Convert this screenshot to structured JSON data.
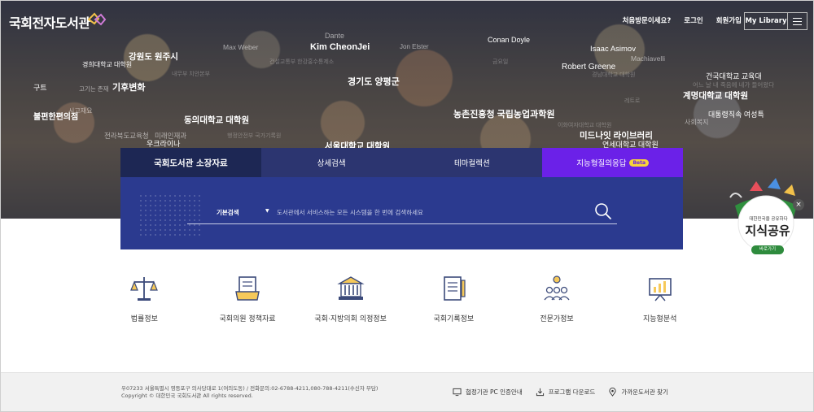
{
  "header": {
    "logo": "국회전자도서관",
    "links": [
      "처음방문이세요?",
      "로그인",
      "회원가입"
    ],
    "my_library": "My Library"
  },
  "keywords": [
    {
      "text": "Dante"
    },
    {
      "text": "Kim CheonJei"
    },
    {
      "text": "Max Weber"
    },
    {
      "text": "Jon Elster"
    },
    {
      "text": "Conan Doyle"
    },
    {
      "text": "Isaac Asimov"
    },
    {
      "text": "Machiavelli"
    },
    {
      "text": "Robert Greene"
    },
    {
      "text": "강원도 원주시"
    },
    {
      "text": "경희대학교 대학원"
    },
    {
      "text": "기후변화"
    },
    {
      "text": "경기도 양평군"
    },
    {
      "text": "건국대학교 교육대"
    },
    {
      "text": "계명대학교 대학원"
    },
    {
      "text": "대통령직속 여성특"
    },
    {
      "text": "사회복지"
    },
    {
      "text": "농촌진흥청 국립농업과학원"
    },
    {
      "text": "동의대학교 대학원"
    },
    {
      "text": "불편한편의점"
    },
    {
      "text": "전라북도교육청"
    },
    {
      "text": "미래인재과"
    },
    {
      "text": "우크라이나"
    },
    {
      "text": "미드나잇 라이브러리"
    },
    {
      "text": "연세대학교 대학원"
    },
    {
      "text": "서울대학교 대학원"
    },
    {
      "text": "구트"
    },
    {
      "text": "고기는 존재"
    },
    {
      "text": "행정안전부 국가기록원"
    },
    {
      "text": "내무부 치안본부"
    },
    {
      "text": "건설교통부 한강홍수통제소"
    },
    {
      "text": "금요일"
    },
    {
      "text": "시고재요"
    },
    {
      "text": "레트로"
    },
    {
      "text": "경남대학교 대학원"
    },
    {
      "text": "이화여자대학교 대학원"
    },
    {
      "text": "어느 날 내 죽음에 네가 들어왔다"
    }
  ],
  "tabs": [
    {
      "label": "국회도서관 소장자료"
    },
    {
      "label": "상세검색"
    },
    {
      "label": "테마컬렉션"
    },
    {
      "label": "지능형질의응답",
      "badge": "Beta"
    }
  ],
  "search": {
    "type": "기본검색",
    "placeholder": "도서관에서 서비스하는 모든 시스템을 한 번에 검색하세요"
  },
  "badge": {
    "sub": "대한민국을 공유하다",
    "main": "지식공유",
    "go": "바로가기"
  },
  "shortcuts": [
    {
      "label": "법률정보",
      "icon": "scales-icon"
    },
    {
      "label": "국회의원 정책자료",
      "icon": "policy-document-icon"
    },
    {
      "label": "국회·지방의회 의정정보",
      "icon": "assembly-building-icon"
    },
    {
      "label": "국회기록정보",
      "icon": "records-notepad-icon"
    },
    {
      "label": "전문가정보",
      "icon": "experts-icon"
    },
    {
      "label": "지능형분석",
      "icon": "analysis-chart-icon"
    }
  ],
  "footer": {
    "address": "우07233 서울특별시 영등포구 의사당대로 1(여의도동) / 전화문의:02-6788-4211,080-788-4211(수신자 부담)",
    "copyright": "Copyright © 대한민국 국회도서관 All rights reserved.",
    "links": [
      {
        "label": "협정기관 PC 인증안내",
        "icon": "monitor-icon"
      },
      {
        "label": "프로그램 다운로드",
        "icon": "download-icon"
      },
      {
        "label": "가까운도서관 찾기",
        "icon": "location-pin-icon"
      }
    ]
  },
  "colors": {
    "tab_active": "#1d2754",
    "tab_default": "#2c3570",
    "tab_ai": "#6b21e8",
    "search_panel": "#2b3a8f"
  }
}
